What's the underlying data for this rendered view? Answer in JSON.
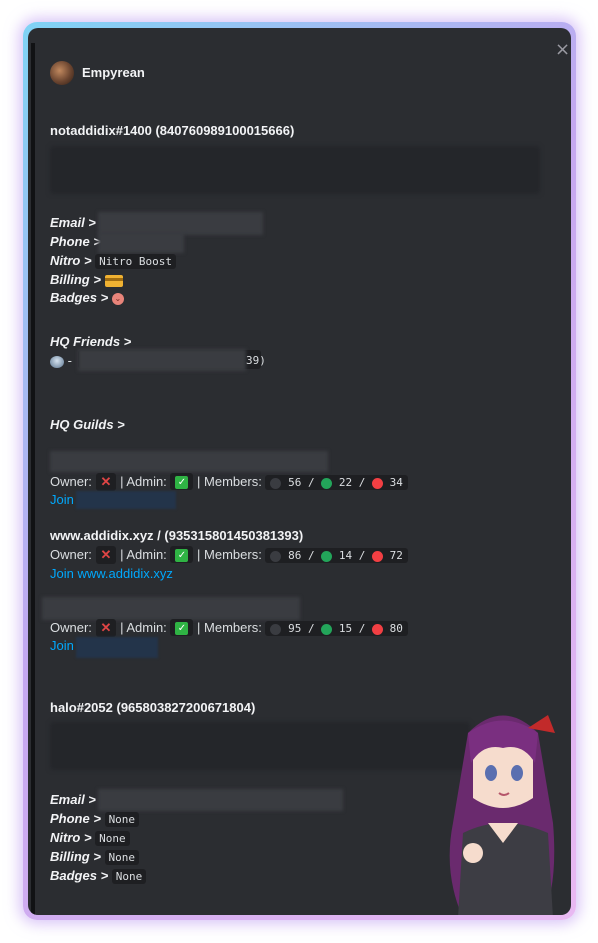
{
  "embed": {
    "author": "Empyrean",
    "close_glyph": "×",
    "user1": {
      "title": "notaddidix#1400 (840760989100015666)",
      "email_label": "Email >",
      "phone_label": "Phone >",
      "nitro_label": "Nitro >",
      "nitro_value": "Nitro Boost",
      "billing_label": "Billing >",
      "badges_label": "Badges >"
    },
    "friends": {
      "title": "HQ Friends >",
      "sep": "-",
      "tail": "39)"
    },
    "guilds": {
      "title": "HQ Guilds >",
      "owner_label": "Owner:",
      "admin_label": "| Admin:",
      "members_label": "| Members:",
      "slash": "/",
      "join_label": "Join",
      "items": [
        {
          "name": "",
          "members": {
            "total": "56",
            "online": "22",
            "dnd": "34"
          },
          "join": "Join"
        },
        {
          "name": "www.addidix.xyz / (935315801450381393)",
          "members": {
            "total": "86",
            "online": "14",
            "dnd": "72"
          },
          "join": "Join www.addidix.xyz"
        },
        {
          "name": "",
          "members": {
            "total": "95",
            "online": "15",
            "dnd": "80"
          },
          "join": "Join"
        }
      ]
    },
    "user2": {
      "title": "halo#2052 (965803827200671804)",
      "email_label": "Email >",
      "phone_label": "Phone >",
      "phone_value": "None",
      "nitro_label": "Nitro >",
      "nitro_value": "None",
      "billing_label": "Billing >",
      "billing_value": "None",
      "badges_label": "Badges >",
      "badges_value": "None"
    }
  },
  "colors": {
    "background": "#2b2d31",
    "link": "#00a8fc",
    "dnd": "#f23f43",
    "online": "#23a55a",
    "offline": "#1e1f22"
  },
  "icons": [
    "close-icon",
    "avatar",
    "credit-card-icon",
    "badge-icon",
    "friend-icon",
    "cross-mark-icon",
    "check-mark-icon",
    "status-dot-icon"
  ]
}
